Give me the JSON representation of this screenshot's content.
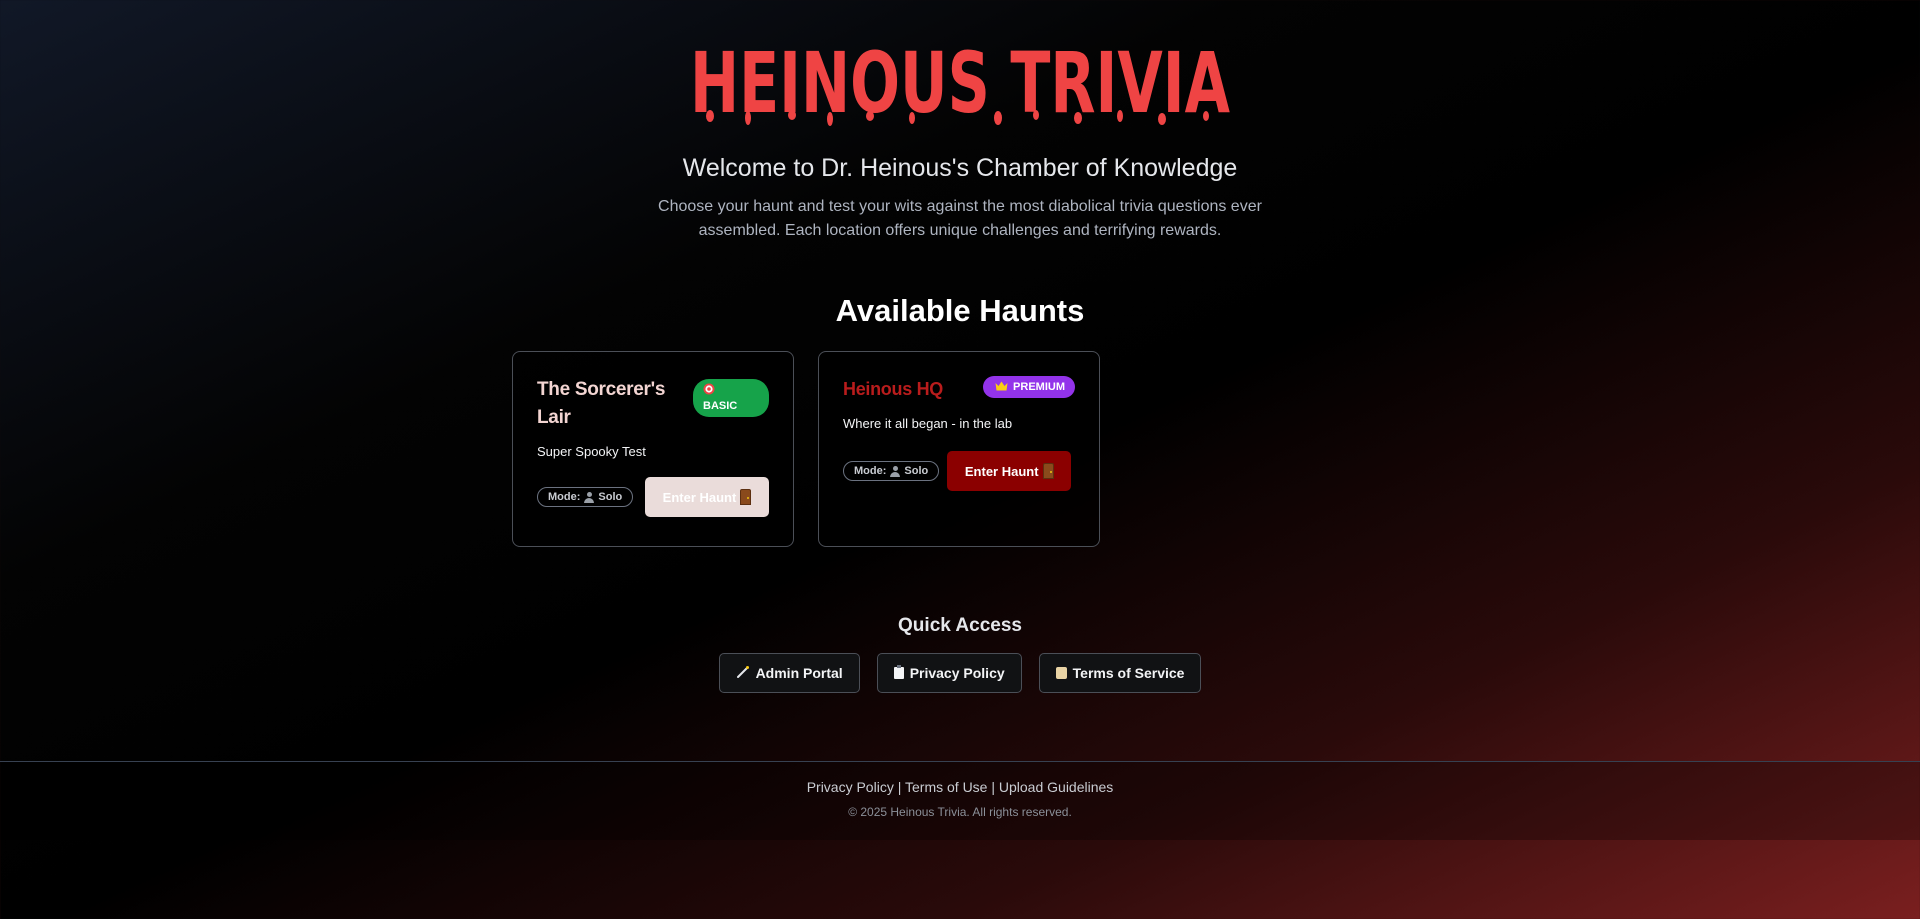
{
  "header": {
    "logo_text": "HEINOUS TRIVIA",
    "welcome": "Welcome to Dr. Heinous's Chamber of Knowledge",
    "intro": "Choose your haunt and test your wits against the most diabolical trivia questions ever assembled. Each location offers unique challenges and terrifying rewards."
  },
  "haunts": {
    "title": "Available Haunts",
    "cards": [
      {
        "title": "The Sorcerer's Lair",
        "badge": "BASIC",
        "badge_icon": "target-icon",
        "description": "Super Spooky Test",
        "mode_label": "Mode:",
        "mode_value": "Solo",
        "enter_label": "Enter Haunt"
      },
      {
        "title": "Heinous HQ",
        "badge": "PREMIUM",
        "badge_icon": "crown-icon",
        "description": "Where it all began - in the lab",
        "mode_label": "Mode:",
        "mode_value": "Solo",
        "enter_label": "Enter Haunt"
      }
    ]
  },
  "quick_access": {
    "title": "Quick Access",
    "buttons": [
      {
        "label": "Admin Portal",
        "icon": "wand-icon"
      },
      {
        "label": "Privacy Policy",
        "icon": "clipboard-icon"
      },
      {
        "label": "Terms of Service",
        "icon": "scroll-icon"
      }
    ]
  },
  "footer": {
    "links": [
      "Privacy Policy",
      "Terms of Use",
      "Upload Guidelines"
    ],
    "separator": "|",
    "copyright": "© 2025 Heinous Trivia. All rights reserved."
  },
  "colors": {
    "logo": "#ef4444",
    "basic_badge": "#16a34a",
    "premium_badge": "#9333ea",
    "enter_dark": "#8b0000",
    "enter_light": "#eadcda",
    "hq_title": "#b91c1c"
  }
}
